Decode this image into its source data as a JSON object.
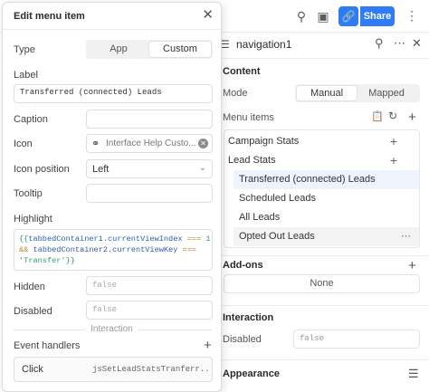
{
  "topbar": {
    "share_label": "Share"
  },
  "inspector": {
    "component_name": "navigation1",
    "content": {
      "title": "Content",
      "mode_label": "Mode",
      "mode_options": [
        "Manual",
        "Mapped"
      ],
      "menu_items_label": "Menu items",
      "items": [
        {
          "label": "Campaign Stats"
        },
        {
          "label": "Lead Stats"
        },
        {
          "label": "Transferred (connected) Leads"
        },
        {
          "label": "Scheduled Leads"
        },
        {
          "label": "All Leads"
        },
        {
          "label": "Opted Out Leads"
        }
      ]
    },
    "addons": {
      "title": "Add-ons",
      "none_label": "None"
    },
    "interaction": {
      "title": "Interaction",
      "disabled_label": "Disabled",
      "disabled_placeholder": "false"
    },
    "appearance": {
      "title": "Appearance"
    }
  },
  "modal": {
    "title": "Edit menu item",
    "type_label": "Type",
    "type_options": [
      "App",
      "Custom"
    ],
    "label_label": "Label",
    "label_value": "Transferred (connected) Leads",
    "caption_label": "Caption",
    "caption_value": "",
    "icon_label": "Icon",
    "icon_value": "Interface Help Custo...",
    "icon_position_label": "Icon position",
    "icon_position_value": "Left",
    "tooltip_label": "Tooltip",
    "tooltip_value": "",
    "highlight_label": "Highlight",
    "highlight_code": {
      "open": "{{",
      "ident1": "tabbedContainer1.currentViewIndex",
      "op1": "===",
      "num": "1",
      "and": "&&",
      "ident2": "tabbedContainer2.currentViewKey",
      "op2": "===",
      "str": "'Transfer'",
      "close": "}}"
    },
    "hidden_label": "Hidden",
    "hidden_placeholder": "false",
    "disabled_label": "Disabled",
    "disabled_placeholder": "false",
    "interaction_divider": "Interaction",
    "event_handlers_label": "Event handlers",
    "handler": {
      "event": "Click",
      "action": "jsSetLeadStatsTranferr..."
    }
  }
}
